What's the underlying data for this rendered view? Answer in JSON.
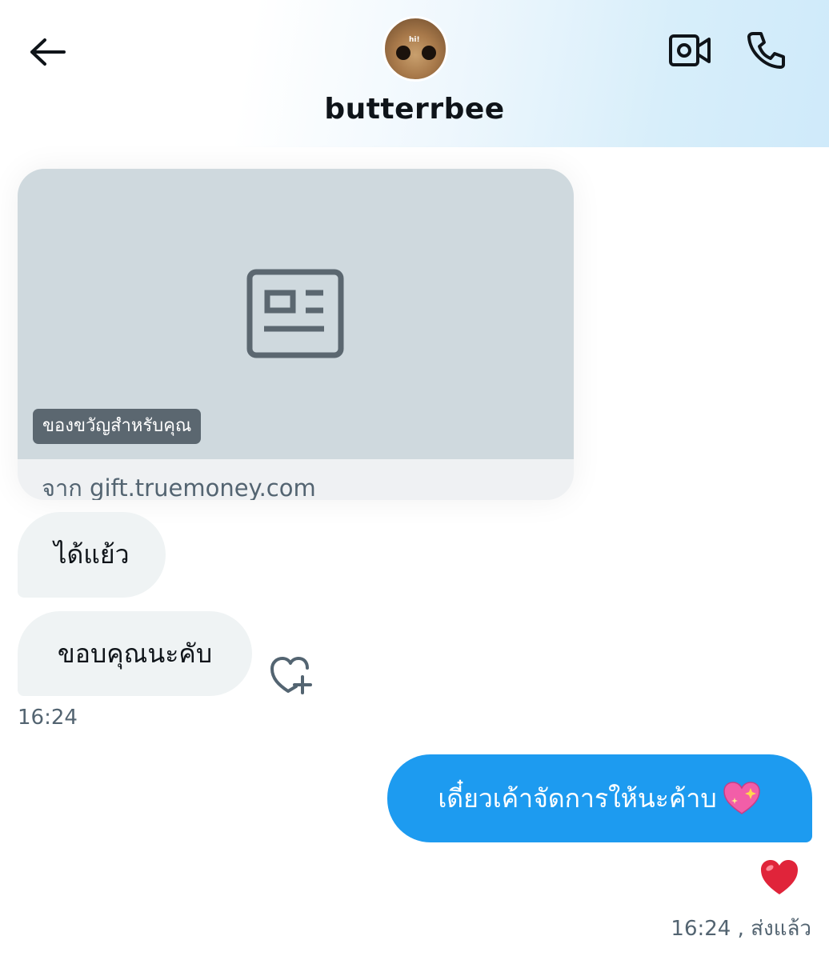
{
  "header": {
    "username": "butterrbee",
    "avatar_text": "hi!",
    "icons": {
      "back": "arrow-left-icon",
      "video": "video-camera-icon",
      "call": "phone-icon"
    }
  },
  "messages": {
    "card": {
      "badge": "ของขวัญสำหรับคุณ",
      "source": "จาก gift.truemoney.com",
      "icon": "article-placeholder-icon"
    },
    "incoming": [
      {
        "text": "ได้แย้ว"
      },
      {
        "text": "ขอบคุณนะคับ"
      }
    ],
    "incoming_time": "16:24",
    "outgoing": {
      "text": "เดี๋ยวเค้าจัดการให้นะค้าบ",
      "emoji": "sparkling-heart-icon"
    },
    "reaction": "red-heart-icon",
    "outgoing_status": "16:24 , ส่งแล้ว"
  },
  "colors": {
    "accent": "#1d9bf0",
    "incoming_bubble": "#eff3f4",
    "secondary_text": "#536471",
    "card_media": "#cfd9de"
  }
}
